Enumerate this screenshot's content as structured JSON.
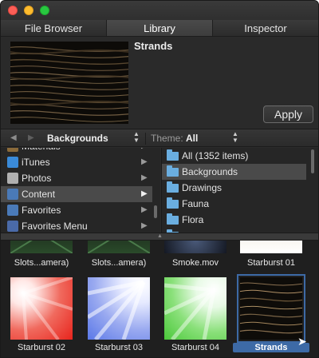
{
  "tabs": [
    {
      "label": "File Browser"
    },
    {
      "label": "Library"
    },
    {
      "label": "Inspector"
    }
  ],
  "active_tab": "Library",
  "preview": {
    "title": "Strands",
    "apply_label": "Apply"
  },
  "nav": {
    "back_icon": "chevron-left",
    "forward_icon": "chevron-right",
    "location": "Backgrounds",
    "theme_label": "Theme:",
    "theme_value": "All"
  },
  "sources": [
    {
      "label": "Materials",
      "icon": "materials-icon",
      "color": "#8a6a3a",
      "selected": false
    },
    {
      "label": "iTunes",
      "icon": "music-icon",
      "color": "#3a8ad8",
      "selected": false
    },
    {
      "label": "Photos",
      "icon": "photos-icon",
      "color": "#b0b0b0",
      "selected": false
    },
    {
      "label": "Content",
      "icon": "folder-icon",
      "color": "#4a7ab8",
      "selected": true
    },
    {
      "label": "Favorites",
      "icon": "favorites-icon",
      "color": "#4a7ab8",
      "selected": false
    },
    {
      "label": "Favorites Menu",
      "icon": "favorites-menu-icon",
      "color": "#4a6aa8",
      "selected": false
    }
  ],
  "folders": [
    {
      "label": "All (1352 items)",
      "selected": false
    },
    {
      "label": "Backgrounds",
      "selected": true
    },
    {
      "label": "Drawings",
      "selected": false
    },
    {
      "label": "Fauna",
      "selected": false
    },
    {
      "label": "Flora",
      "selected": false
    }
  ],
  "items_row1": [
    {
      "label": "Slots...amera)"
    },
    {
      "label": "Slots...amera)"
    },
    {
      "label": "Smoke.mov"
    },
    {
      "label": "Starburst 01"
    }
  ],
  "items_row2": [
    {
      "label": "Starburst 02",
      "accent": "#e8241c"
    },
    {
      "label": "Starburst 03",
      "accent": "#5a78e8"
    },
    {
      "label": "Starburst 04",
      "accent": "#4ac83a"
    },
    {
      "label": "Strands",
      "accent": "#3d6aa6",
      "selected": true
    }
  ],
  "colors": {
    "selection": "#3d6aa6",
    "folder": "#6aaee0"
  }
}
